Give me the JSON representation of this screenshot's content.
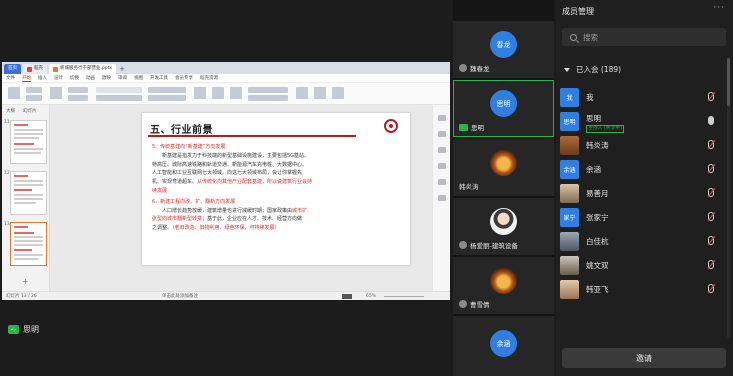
{
  "shared_screen": {
    "wps_tabs": [
      {
        "label": "首页",
        "color": "#3c6fd6"
      },
      {
        "label": "稻壳",
        "color": "#e0453a"
      },
      {
        "label": "新城服务行干部营业.pptx",
        "color": "#e07a33"
      }
    ],
    "ribbon_menu": [
      "文件",
      "开始",
      "插入",
      "设计",
      "切换",
      "动画",
      "放映",
      "审阅",
      "视图",
      "开发工具",
      "会员专享",
      "稻壳资源"
    ],
    "thumbs_header": [
      "大纲",
      "幻灯片"
    ],
    "thumb_numbers": [
      "11",
      "12",
      "13"
    ],
    "slide": {
      "title": "五、行业前景",
      "lines": [
        {
          "text": "5、传统基建向“新基建”方向发展",
          "style": "h"
        },
        {
          "text": "新基建是指发力于科技端的新型基础设施建设，主要包括5G基站、",
          "style": "ind"
        },
        {
          "text": "特高压、城际高速铁路和轨道交通、新能源汽车充电桩、大数据中心、",
          "style": ""
        },
        {
          "text": "人工智能和工业互联网七大领域。向这七大领域布局，会让你掌握先",
          "style": ""
        },
        {
          "text": "机、实现弯道超车。从传统化向其他产业配套基建，所以说建筑行业会持",
          "style": "mixed"
        },
        {
          "text": "续发展",
          "style": "red"
        },
        {
          "text": "6、新建工程向改、扩、翻新方向发展",
          "style": "h"
        },
        {
          "text": "人口增长趋势放缓，建筑增量也进行减缓时期；国家政策由城市扩",
          "style": "ind"
        },
        {
          "text": "张型向城市翻新型转变；基于此，企业应在人才、技术、经营方向做",
          "style": ""
        },
        {
          "text": "之调整。（老旧改造、旧物利用、绿色环保、可持续发展）",
          "style": ""
        }
      ],
      "mixed_black": "机、实现弯道超车。",
      "mixed_red": "从传统化向其他产业配套基建，所以说建筑行业会持",
      "l8_black": "人口增长趋势放缓，建筑增量也进行减缓时期；国家政策由",
      "l8_red": "城市扩",
      "l9_red": "张型向城市翻新型转变；",
      "l9_black": "基于此，企业应在人才、技术、经营方向做",
      "l10_black": "之调整。",
      "l10_red": "（老旧改造、旧物利用、绿色环保、可持续发展）"
    },
    "notes_placeholder": "单击此处添加备注",
    "status_left": "幻灯片 13 / 26",
    "status_right": "65%"
  },
  "active_speaker": {
    "name": "思明"
  },
  "video_tiles": [
    {
      "avatar_text": "春龙",
      "name": "魏春龙",
      "avatar_color": "#2f7ee0",
      "kind": "text"
    },
    {
      "avatar_text": "思明",
      "name": "思明",
      "avatar_color": "#2f7ee0",
      "kind": "text",
      "speaking": true
    },
    {
      "avatar_text": "",
      "name": "韩炎涛",
      "kind": "fire"
    },
    {
      "avatar_text": "",
      "name": "杨爱丽-建筑设备",
      "kind": "photo"
    },
    {
      "avatar_text": "",
      "name": "曹雪倩",
      "kind": "fire"
    },
    {
      "avatar_text": "余涵",
      "name": "",
      "avatar_color": "#2f7ee0",
      "kind": "text"
    }
  ],
  "panel": {
    "title": "成员管理",
    "more_icon": "more-icon",
    "search_placeholder": "搜索",
    "group_label": "已入会 (189)",
    "members": [
      {
        "avatar_text": "我",
        "name": "我",
        "mic": "off"
      },
      {
        "avatar_text": "思明",
        "name": "思明",
        "tag": "主持人 (共享中)",
        "mic": "on"
      },
      {
        "avatar_text": "",
        "name": "韩炎涛",
        "mic": "off",
        "img": "img-a"
      },
      {
        "avatar_text": "余涵",
        "name": "余涵",
        "mic": "off"
      },
      {
        "avatar_text": "",
        "name": "易善月",
        "mic": "off",
        "img": "img-b"
      },
      {
        "avatar_text": "家宁",
        "name": "张家宁",
        "mic": "off"
      },
      {
        "avatar_text": "",
        "name": "白佳杭",
        "mic": "off",
        "img": "img-c"
      },
      {
        "avatar_text": "",
        "name": "姚文双",
        "mic": "off",
        "img": "img-d"
      },
      {
        "avatar_text": "",
        "name": "韩亚飞",
        "mic": "off",
        "img": "img-e"
      }
    ],
    "invite_label": "邀请"
  },
  "colors": {
    "accent_green": "#2bb24c",
    "avatar_blue": "#2f7ee0",
    "slide_red": "#d22d2d"
  }
}
